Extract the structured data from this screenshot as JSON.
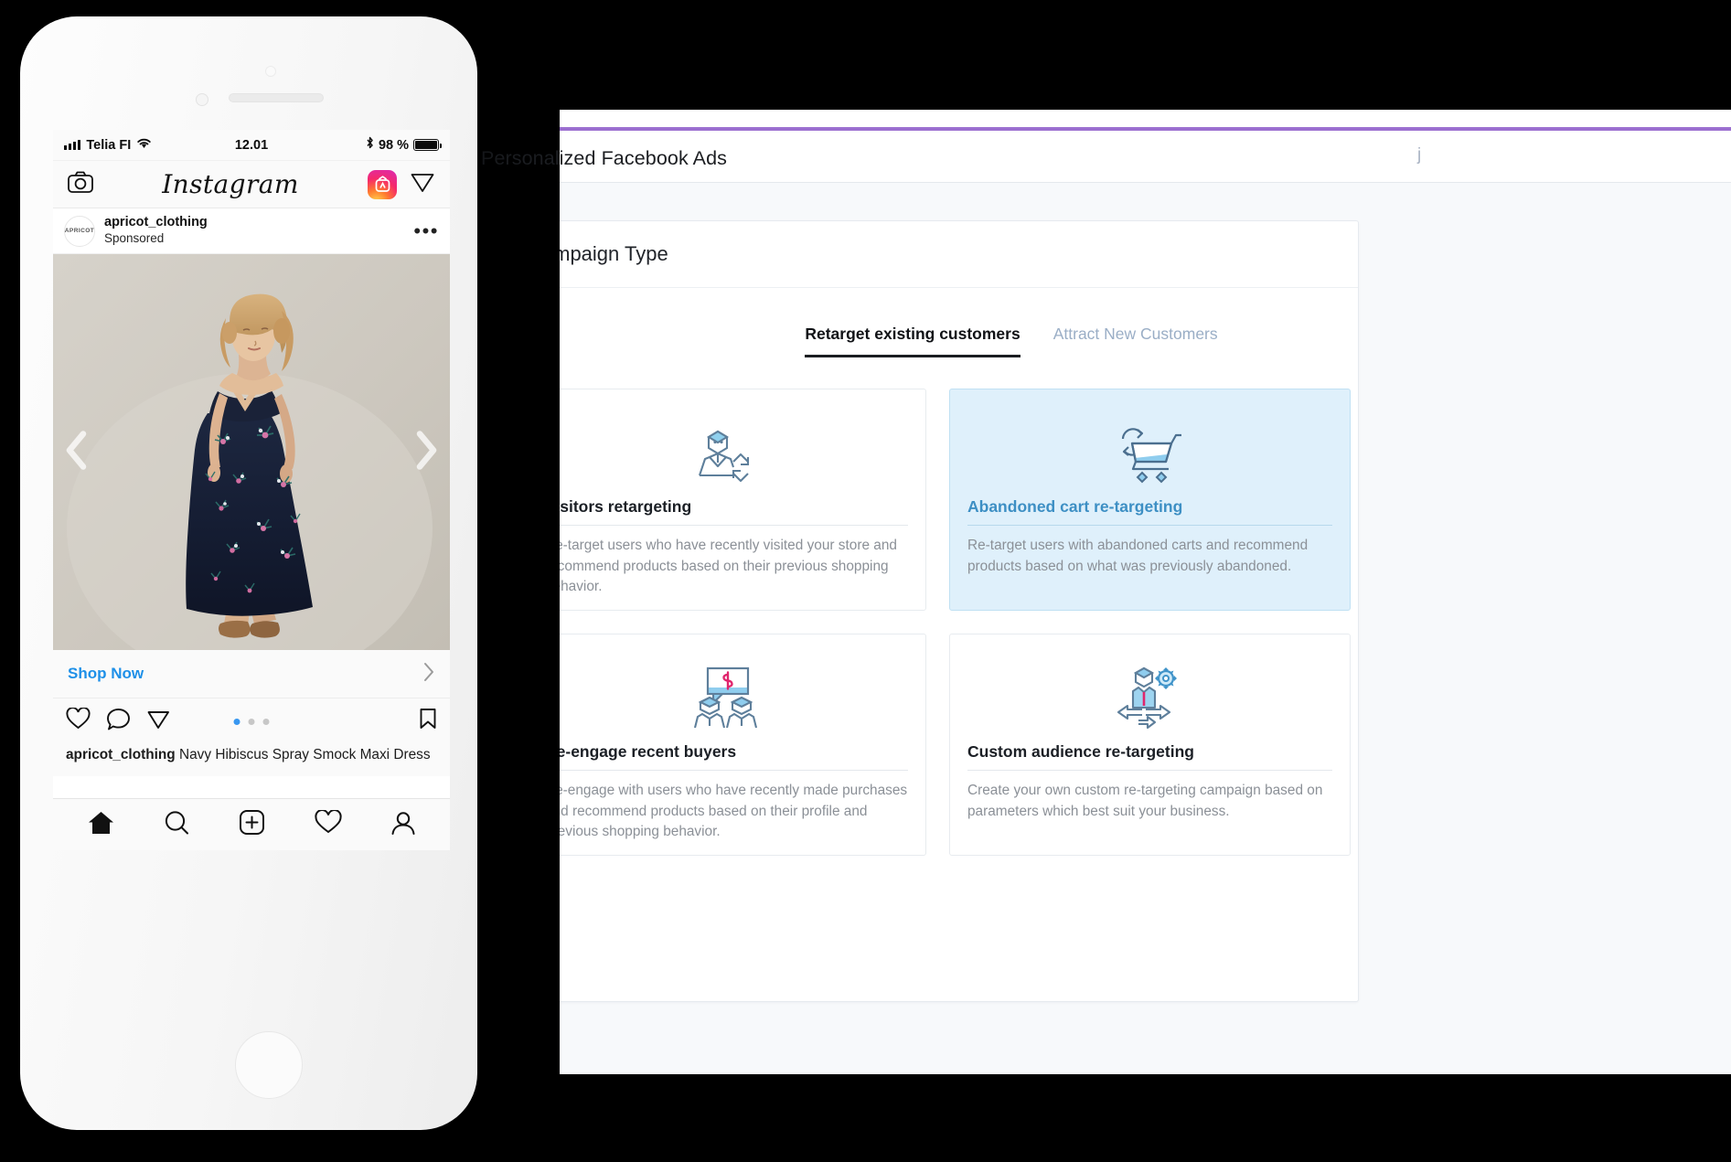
{
  "tablet": {
    "title": "Personalized Facebook Ads",
    "marker": "j",
    "accent_color": "#9b6fd0",
    "panel": {
      "title": "Campaign Type",
      "tabs": [
        {
          "label": "Retarget existing customers",
          "active": true
        },
        {
          "label": "Attract New Customers",
          "active": false
        }
      ],
      "cards": [
        {
          "icon": "visitor-retargeting-icon",
          "title": "Visitors retargeting",
          "desc": "Re-target users who have recently visited your store and recommend products based on their previous shopping behavior.",
          "selected": false
        },
        {
          "icon": "abandoned-cart-icon",
          "title": "Abandoned cart re-targeting",
          "desc": "Re-target users with abandoned carts and recommend products based on what was previously abandoned.",
          "selected": true
        },
        {
          "icon": "re-engage-buyers-icon",
          "title": "Re-engage recent buyers",
          "desc": "Re-engage with users who have recently made purchases and recommend products based on their profile and previous shopping behavior.",
          "selected": false
        },
        {
          "icon": "custom-audience-icon",
          "title": "Custom audience re-targeting",
          "desc": "Create your own custom re-targeting campaign based on parameters which best suit your business.",
          "selected": false
        }
      ],
      "selected_color": "#3d8fc4",
      "selected_bg": "#dff0fb"
    }
  },
  "phone": {
    "statusbar": {
      "carrier": "Telia FI",
      "time": "12.01",
      "battery_percent": "98 %",
      "icons": [
        "signal-icon",
        "wifi-icon",
        "bluetooth-icon",
        "battery-icon"
      ]
    },
    "instagram": {
      "logo": "Instagram",
      "header_icons": [
        "camera-icon",
        "igtv-icon",
        "direct-message-icon"
      ],
      "post": {
        "avatar_text": "APRICOT",
        "username": "apricot_clothing",
        "subtitle": "Sponsored",
        "more_label": "•••",
        "cta_label": "Shop Now",
        "carousel_dots": 3,
        "carousel_active_index": 0,
        "action_icons": [
          "heart-icon",
          "comment-icon",
          "share-icon",
          "bookmark-icon"
        ],
        "caption_user": "apricot_clothing",
        "caption_text": " Navy Hibiscus Spray Smock Maxi Dress",
        "cta_color": "#1e90e8",
        "active_dot_color": "#3897f0"
      },
      "tabbar_icons": [
        "home-icon",
        "search-icon",
        "add-post-icon",
        "activity-icon",
        "profile-icon"
      ]
    }
  }
}
